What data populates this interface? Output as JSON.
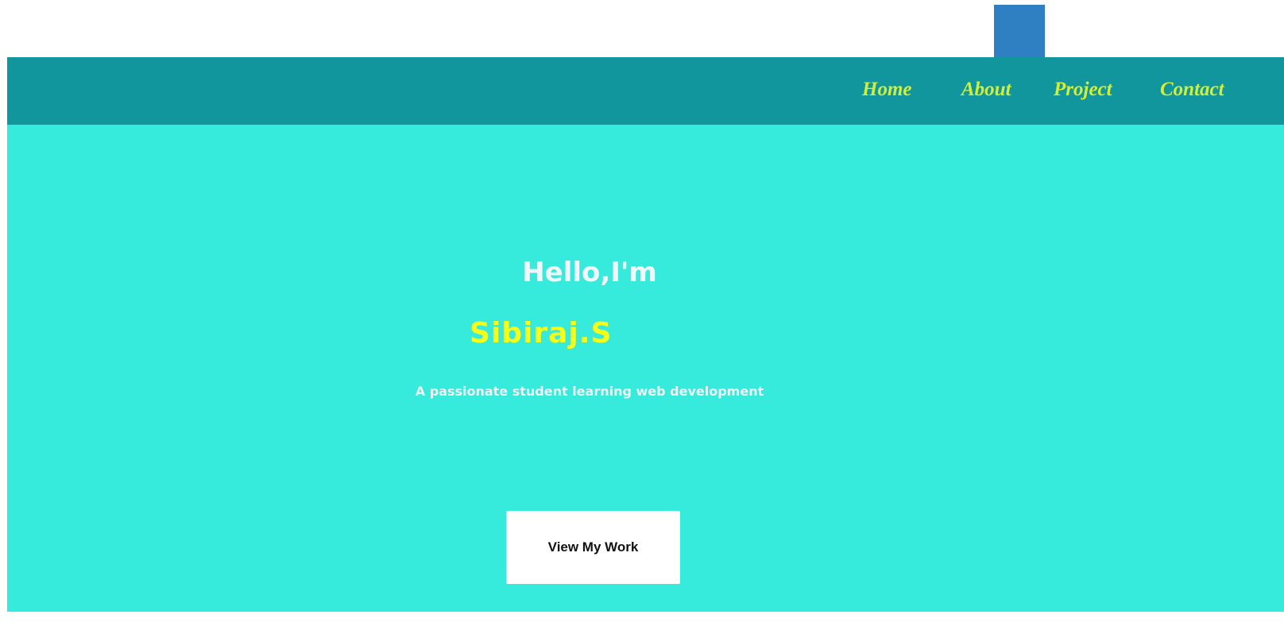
{
  "nav": {
    "items": [
      {
        "label": "Home"
      },
      {
        "label": "About"
      },
      {
        "label": "Project"
      },
      {
        "label": "Contact"
      }
    ]
  },
  "hero": {
    "greeting": "Hello,I'm",
    "name": "Sibiraj.S",
    "tagline": "A passionate student learning web development",
    "cta_label": "View My Work"
  },
  "colors": {
    "navbar_bg": "#12969e",
    "hero_bg": "#36eadc",
    "nav_link": "#d4ee35",
    "name": "#f7ff17",
    "accent_square": "#2f80c2"
  }
}
